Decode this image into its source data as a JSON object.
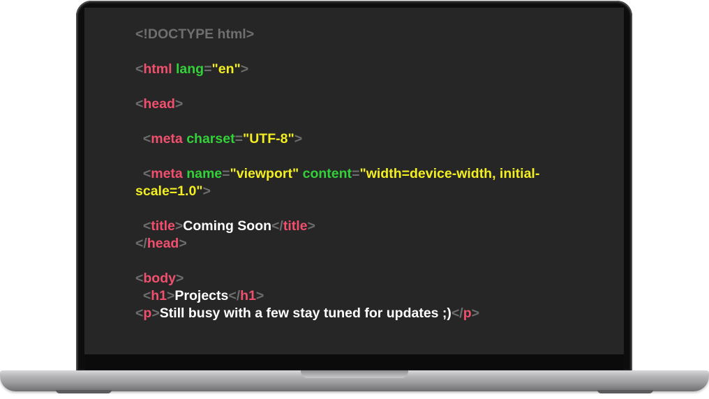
{
  "code": {
    "doctype": "<!DOCTYPE html>",
    "lt": "<",
    "gt": ">",
    "eq": "=",
    "quote": "\"",
    "close_lt": "</",
    "html_tag": "html",
    "lang_attr": "lang",
    "lang_val": "en",
    "head_tag": "head",
    "meta_tag": "meta",
    "charset_attr": "charset",
    "charset_val": "UTF-8",
    "name_attr": "name",
    "name_val": "viewport",
    "content_attr": "content",
    "content_val": "width=device-width, initial-scale=1.0",
    "title_tag": "title",
    "title_text": "Coming Soon",
    "body_tag": "body",
    "h1_tag": "h1",
    "h1_text": "Projects",
    "p_tag": "p",
    "p_text": "Still busy with a few stay tuned for updates ;)"
  },
  "colors": {
    "screen_bg": "#262626",
    "tag": "#f0506e",
    "attribute": "#34d03a",
    "value": "#f3ee22",
    "text": "#ffffff",
    "punctuation": "#6d6d6d"
  }
}
